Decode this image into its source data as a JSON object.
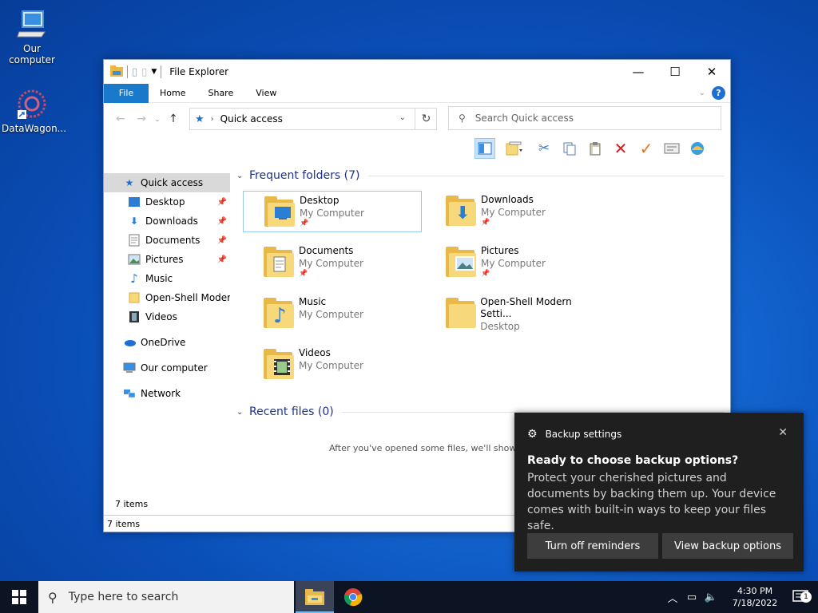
{
  "desktop": {
    "icons": [
      {
        "label": "Our computer",
        "icon": "computer-icon"
      },
      {
        "label": "DataWagon...",
        "icon": "datawagon-shortcut-icon"
      }
    ]
  },
  "window": {
    "title": "File Explorer",
    "controls": {
      "minimize": "—",
      "maximize": "☐",
      "close": "✕"
    },
    "ribbon_tabs": [
      "File",
      "Home",
      "Share",
      "View"
    ],
    "help": "?",
    "address": {
      "location": "Quick access",
      "separator": "›"
    },
    "search": {
      "placeholder": "Search Quick access"
    },
    "sidebar": {
      "quick_access": "Quick access",
      "pinned": [
        "Desktop",
        "Downloads",
        "Documents",
        "Pictures"
      ],
      "unpinned": [
        "Music",
        "Open-Shell Modern",
        "Videos"
      ],
      "onedrive": "OneDrive",
      "computer": "Our computer",
      "network": "Network"
    },
    "frequent": {
      "header": "Frequent folders (7)",
      "items": [
        {
          "name": "Desktop",
          "sub": "My Computer",
          "pinned": true
        },
        {
          "name": "Downloads",
          "sub": "My Computer",
          "pinned": true
        },
        {
          "name": "Documents",
          "sub": "My Computer",
          "pinned": true
        },
        {
          "name": "Pictures",
          "sub": "My Computer",
          "pinned": true
        },
        {
          "name": "Music",
          "sub": "My Computer",
          "pinned": false
        },
        {
          "name": "Open-Shell Modern Setti...",
          "sub": "Desktop",
          "pinned": false
        },
        {
          "name": "Videos",
          "sub": "My Computer",
          "pinned": false
        }
      ]
    },
    "recent": {
      "header": "Recent files (0)",
      "message": "After you've opened some files, we'll show"
    },
    "status": {
      "items_top": "7 items",
      "items_bottom": "7 items"
    }
  },
  "toast": {
    "app": "Backup settings",
    "close": "✕",
    "title": "Ready to choose backup options?",
    "body": "Protect your cherished pictures and documents by backing them up. Your device comes with built-in ways to keep your files safe.",
    "buttons": [
      "Turn off reminders",
      "View backup options"
    ]
  },
  "taskbar": {
    "search_placeholder": "Type here to search",
    "time": "4:30 PM",
    "date": "7/18/2022",
    "notification_count": "1"
  }
}
